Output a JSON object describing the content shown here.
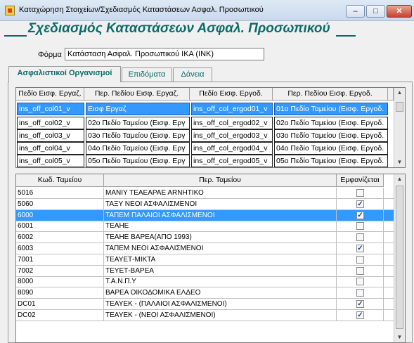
{
  "window": {
    "title": "Καταχώρηση Στοιχείων/Σχεδιασμός Καταστάσεων Ασφαλ. Προσωπικού",
    "min_label": "–",
    "max_label": "□",
    "close_label": "✕"
  },
  "heading": "Σχεδιασμός Καταστάσεων Ασφαλ. Προσωπικού",
  "form": {
    "label": "Φόρμα",
    "value": "Κατάσταση Ασφαλ. Προσωπικού ΙΚΑ (INK)"
  },
  "tabs": [
    "Ασφαλιστικοί Οργανισμοί",
    "Επιδόματα",
    "Δάνεια"
  ],
  "top_grid": {
    "headers": [
      "Πεδίο Εισφ. Εργαζ.",
      "Περ. Πεδίου Εισφ. Εργαζ.",
      "Πεδίο Εισφ. Εργοδ.",
      "Περ. Πεδίου Εισφ. Εργοδ."
    ],
    "rows": [
      [
        "ins_off_col01_v",
        "Εισφ Εργαζ",
        "ins_off_col_ergod01_v",
        "01ο Πεδίο Ταμείου (Εισφ. Εργοδ."
      ],
      [
        "ins_off_col02_v",
        "02ο Πεδίο Ταμείου (Εισφ. Εργ",
        "ins_off_col_ergod02_v",
        "02ο Πεδίο Ταμείου (Εισφ. Εργοδ."
      ],
      [
        "ins_off_col03_v",
        "03ο Πεδίο Ταμείου (Εισφ. Εργ",
        "ins_off_col_ergod03_v",
        "03ο Πεδίο Ταμείου (Εισφ. Εργοδ."
      ],
      [
        "ins_off_col04_v",
        "04ο Πεδίο Ταμείου (Εισφ. Εργ",
        "ins_off_col_ergod04_v",
        "04ο Πεδίο Ταμείου (Εισφ. Εργοδ."
      ],
      [
        "ins_off_col05_v",
        "05ο Πεδίο Ταμείου (Εισφ. Εργ",
        "ins_off_col_ergod05_v",
        "05ο Πεδίο Ταμείου (Εισφ. Εργοδ."
      ]
    ]
  },
  "bottom_grid": {
    "headers": [
      "Κωδ. Ταμείου",
      "Περ. Ταμείου",
      "Εμφανίζεται"
    ],
    "rows": [
      {
        "code": "5016",
        "desc": "ΜΑΝΙΥ ΤΕΑΕΑΡΑΕ ΑRΝΗΤΙΚΟ",
        "shown": false
      },
      {
        "code": "5060",
        "desc": "ΤΑΞΥ ΝΕΟΙ ΑΣΦΑΛΙΣΜΕΝΟΙ",
        "shown": true
      },
      {
        "code": "6000",
        "desc": "ΤΑΠΕΜ ΠΑΛΑΙΟΙ ΑΣΦΑΛΙΣΜΕΝΟΙ",
        "shown": true
      },
      {
        "code": "6001",
        "desc": "ΤΕΑΗΕ",
        "shown": false
      },
      {
        "code": "6002",
        "desc": "ΤΕΑΗΕ ΒΑΡΕΑ(ΑΠΟ 1993)",
        "shown": false
      },
      {
        "code": "6003",
        "desc": "ΤΑΠΕΜ ΝΕΟΙ ΑΣΦΑΛΙΣΜΕΝΟΙ",
        "shown": true
      },
      {
        "code": "7001",
        "desc": "ΤΕΑΥΕΤ-ΜΙΚΤΑ",
        "shown": false
      },
      {
        "code": "7002",
        "desc": "ΤΕΥΕΤ-ΒΑΡΕΑ",
        "shown": false
      },
      {
        "code": "8000",
        "desc": "Τ.Α.Ν.Π.Υ",
        "shown": false
      },
      {
        "code": "8090",
        "desc": "ΒΑΡΕΑ ΟΙΚΟΔΟΜΙΚΑ ΕΛΔΕΟ",
        "shown": false
      },
      {
        "code": "DC01",
        "desc": "ΤΕΑΥΕΚ - (ΠΑΛΑΙΟΙ ΑΣΦΑΛΙΣΜΕΝΟΙ)",
        "shown": true
      },
      {
        "code": "DC02",
        "desc": "ΤΕΑΥΕΚ - (ΝΕΟΙ ΑΣΦΑΛΙΣΜΕΝΟΙ)",
        "shown": true
      }
    ]
  },
  "colors": {
    "accent": "#0a6b69",
    "selection": "#3399ff"
  }
}
